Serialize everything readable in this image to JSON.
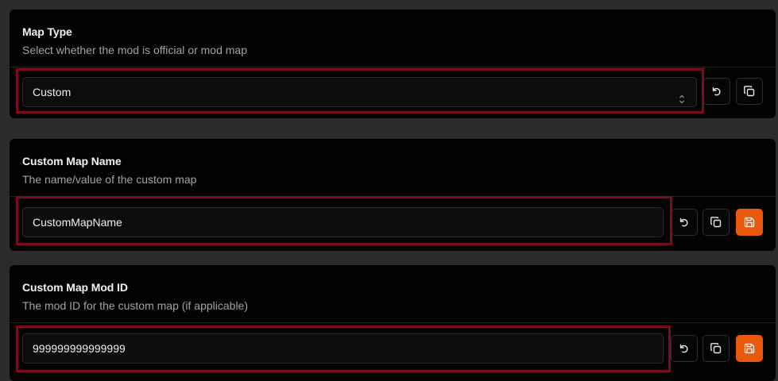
{
  "sections": [
    {
      "title": "Map Type",
      "description": "Select whether the mod is official or mod map",
      "value": "Custom",
      "control": "select"
    },
    {
      "title": "Custom Map Name",
      "description": "The name/value of the custom map",
      "value": "CustomMapName",
      "control": "text"
    },
    {
      "title": "Custom Map Mod ID",
      "description": "The mod ID for the custom map (if applicable)",
      "value": "999999999999999",
      "control": "text"
    }
  ],
  "icons": {
    "reset": "undo-icon",
    "copy": "copy-icon",
    "save": "save-icon",
    "select": "chevron-up-down-icon"
  },
  "colors": {
    "highlight": "#7a0c1d",
    "save_button": "#ea580c"
  }
}
